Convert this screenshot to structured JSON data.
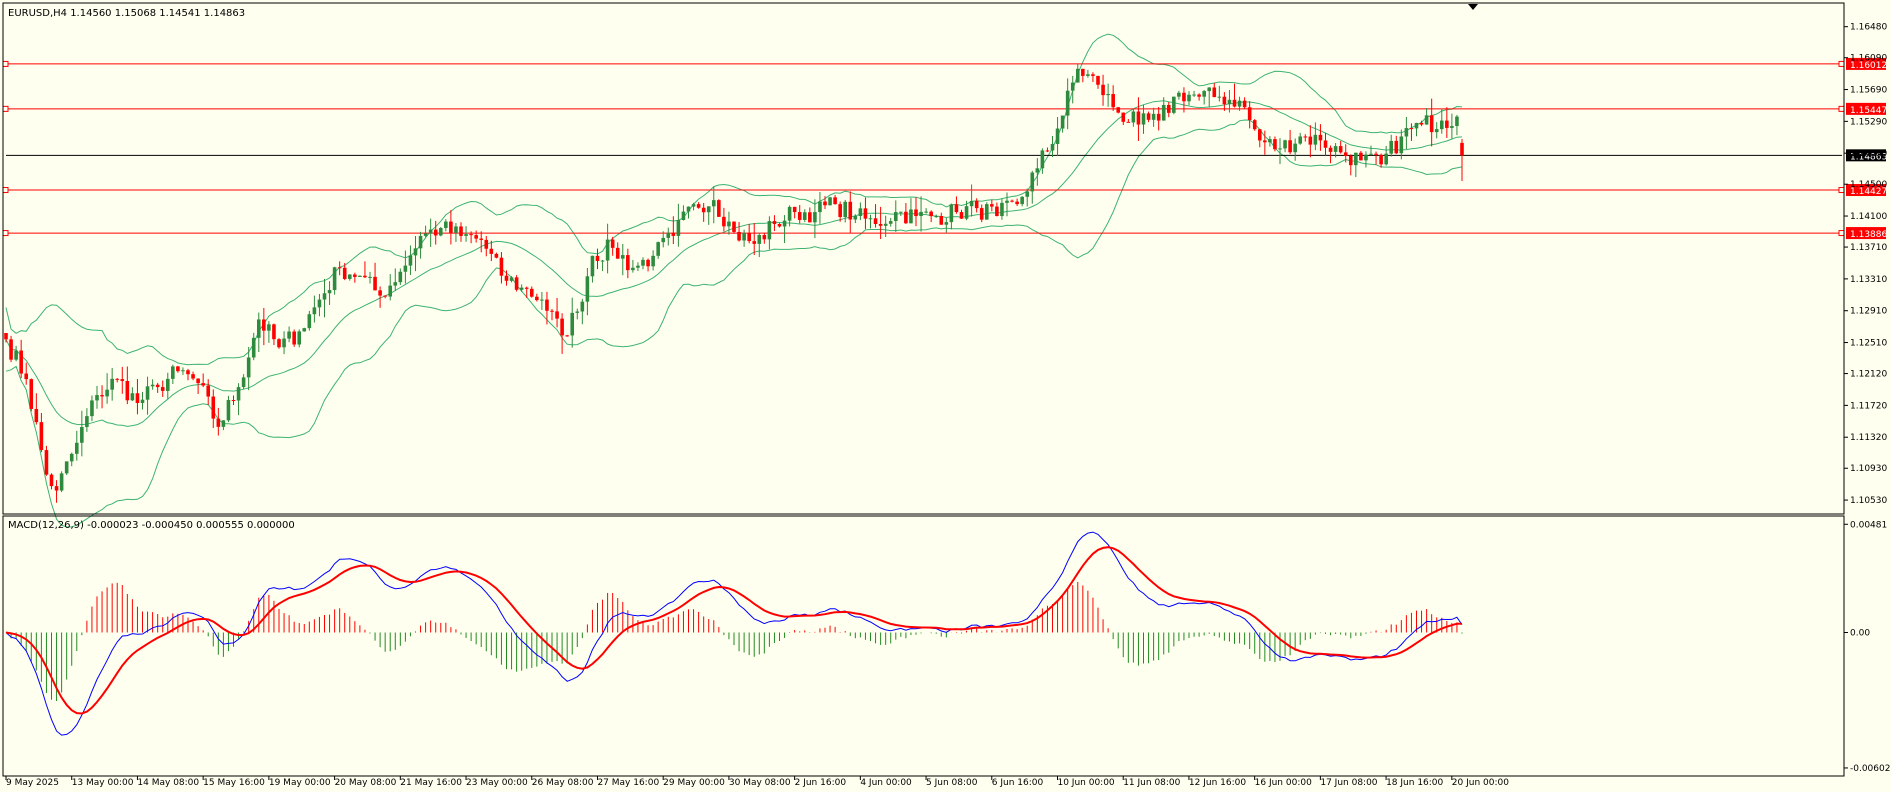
{
  "colors": {
    "background": "#fffff0",
    "bull": "#2e8b3e",
    "bear": "#ff0000",
    "bollinger": "#3cb371",
    "hline": "#ff0000",
    "price_line": "#000000",
    "macd_line": "#0000ff",
    "signal_line": "#ff0000",
    "hist_pos": "#ff0000",
    "hist_neg": "#228b22"
  },
  "chart_data": [
    {
      "type": "candlestick",
      "header": "EURUSD,H4  1.14560 1.15068 1.14541 1.14863",
      "ylim": [
        1.1038,
        1.1674
      ],
      "y_ticks": [
        "1.16480",
        "1.16090",
        "1.15690",
        "1.15290",
        "1.14890",
        "1.14500",
        "1.14100",
        "1.13710",
        "1.13310",
        "1.12910",
        "1.12510",
        "1.12120",
        "1.11720",
        "1.11320",
        "1.10930",
        "1.10530"
      ],
      "horizontal_levels": [
        {
          "value": 1.16012,
          "label": "1.16012",
          "color": "#ff0000"
        },
        {
          "value": 1.15447,
          "label": "1.15447",
          "color": "#ff0000"
        },
        {
          "value": 1.14863,
          "label": "1.14863",
          "color": "#000000"
        },
        {
          "value": 1.14427,
          "label": "1.14427",
          "color": "#ff0000"
        },
        {
          "value": 1.13886,
          "label": "1.13886",
          "color": "#ff0000"
        }
      ],
      "x_labels": [
        "9 May 2025",
        "13 May 00:00",
        "14 May 08:00",
        "15 May 16:00",
        "19 May 00:00",
        "20 May 08:00",
        "21 May 16:00",
        "23 May 00:00",
        "26 May 08:00",
        "27 May 16:00",
        "29 May 00:00",
        "30 May 08:00",
        "2 Jun 16:00",
        "4 Jun 00:00",
        "5 Jun 08:00",
        "6 Jun 16:00",
        "10 Jun 00:00",
        "11 Jun 08:00",
        "12 Jun 16:00",
        "16 Jun 00:00",
        "17 Jun 08:00",
        "18 Jun 16:00",
        "20 Jun 00:00"
      ],
      "close_anchors": [
        [
          0,
          1.1255
        ],
        [
          4,
          1.1205
        ],
        [
          8,
          1.1085
        ],
        [
          10,
          1.1065
        ],
        [
          14,
          1.1125
        ],
        [
          18,
          1.1185
        ],
        [
          22,
          1.1205
        ],
        [
          26,
          1.1175
        ],
        [
          30,
          1.1195
        ],
        [
          34,
          1.1215
        ],
        [
          38,
          1.12
        ],
        [
          42,
          1.1145
        ],
        [
          46,
          1.1195
        ],
        [
          50,
          1.128
        ],
        [
          54,
          1.1245
        ],
        [
          58,
          1.1265
        ],
        [
          62,
          1.1305
        ],
        [
          66,
          1.1345
        ],
        [
          70,
          1.1335
        ],
        [
          74,
          1.131
        ],
        [
          78,
          1.134
        ],
        [
          82,
          1.1385
        ],
        [
          86,
          1.1395
        ],
        [
          90,
          1.1385
        ],
        [
          94,
          1.138
        ],
        [
          98,
          1.1335
        ],
        [
          102,
          1.132
        ],
        [
          106,
          1.1305
        ],
        [
          110,
          1.126
        ],
        [
          113,
          1.129
        ],
        [
          116,
          1.136
        ],
        [
          120,
          1.137
        ],
        [
          124,
          1.1345
        ],
        [
          128,
          1.136
        ],
        [
          132,
          1.1385
        ],
        [
          136,
          1.1425
        ],
        [
          140,
          1.143
        ],
        [
          144,
          1.139
        ],
        [
          148,
          1.1375
        ],
        [
          152,
          1.14
        ],
        [
          156,
          1.1415
        ],
        [
          160,
          1.1415
        ],
        [
          164,
          1.1425
        ],
        [
          168,
          1.141
        ],
        [
          172,
          1.14
        ],
        [
          176,
          1.1415
        ],
        [
          180,
          1.141
        ],
        [
          184,
          1.141
        ],
        [
          188,
          1.1415
        ],
        [
          192,
          1.142
        ],
        [
          196,
          1.141
        ],
        [
          200,
          1.1425
        ],
        [
          204,
          1.147
        ],
        [
          208,
          1.152
        ],
        [
          212,
          1.1595
        ],
        [
          216,
          1.1575
        ],
        [
          220,
          1.154
        ],
        [
          224,
          1.1525
        ],
        [
          228,
          1.153
        ],
        [
          232,
          1.1565
        ],
        [
          236,
          1.156
        ],
        [
          240,
          1.156
        ],
        [
          244,
          1.1555
        ],
        [
          248,
          1.1505
        ],
        [
          252,
          1.1495
        ],
        [
          256,
          1.151
        ],
        [
          260,
          1.1505
        ],
        [
          264,
          1.149
        ],
        [
          268,
          1.148
        ],
        [
          272,
          1.1475
        ],
        [
          276,
          1.151
        ],
        [
          280,
          1.1525
        ],
        [
          284,
          1.153
        ],
        [
          287,
          1.1535
        ],
        [
          288,
          1.1486
        ]
      ],
      "series": [
        {
          "name": "Upper Band"
        },
        {
          "name": "Middle Band"
        },
        {
          "name": "Lower Band"
        }
      ]
    },
    {
      "type": "line+bar",
      "header": "MACD(12,26,9) -0.000023 -0.000450 0.000555 0.000000",
      "ylim": [
        -0.0062,
        0.005
      ],
      "y_ticks": [
        "0.00481",
        "0.00",
        "-0.00602"
      ],
      "series": [
        {
          "name": "MACD"
        },
        {
          "name": "Signal"
        },
        {
          "name": "Histogram"
        }
      ]
    }
  ]
}
